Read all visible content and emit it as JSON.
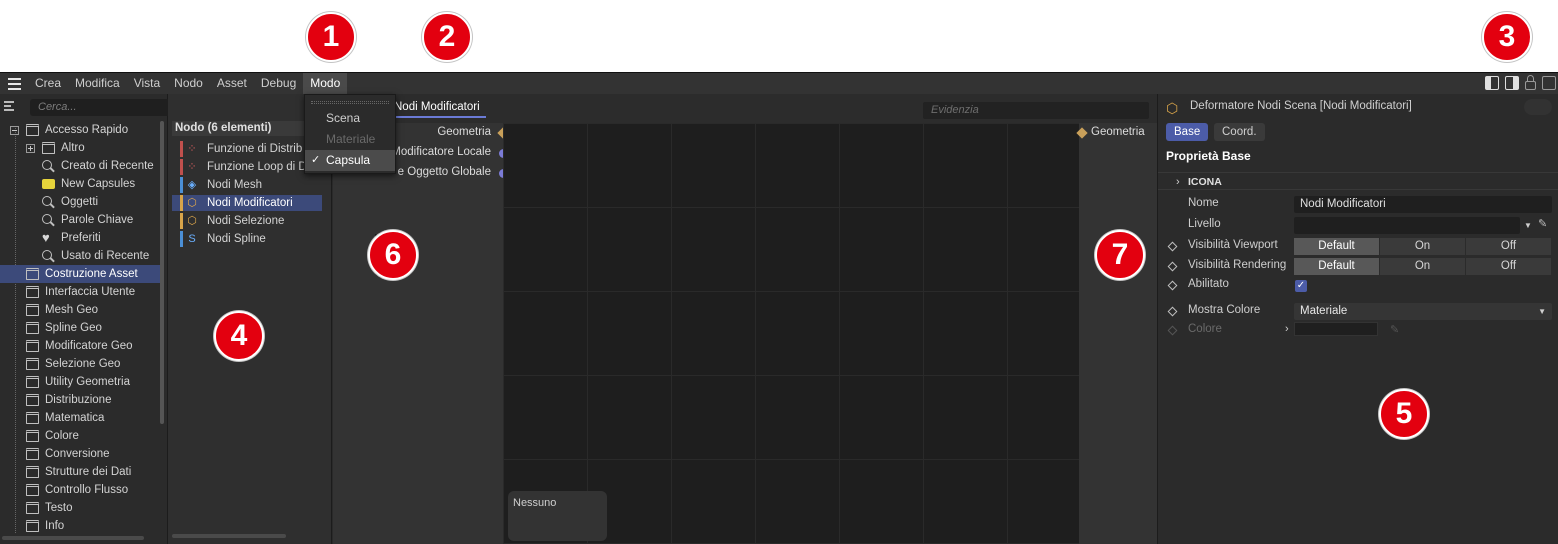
{
  "callouts": [
    "1",
    "2",
    "3",
    "4",
    "5",
    "6",
    "7"
  ],
  "menubar": {
    "items": [
      "Crea",
      "Modifica",
      "Vista",
      "Nodo",
      "Asset",
      "Debug",
      "Modo"
    ],
    "active": "Modo"
  },
  "mode_menu": {
    "items": [
      {
        "label": "Scena",
        "state": "normal"
      },
      {
        "label": "Materiale",
        "state": "disabled"
      },
      {
        "label": "Capsula",
        "state": "checked"
      }
    ],
    "check_glyph": "✓"
  },
  "tree": {
    "search_placeholder": "Cerca...",
    "items": [
      {
        "label": "Accesso Rapido",
        "icon": "database-icon",
        "level": 0,
        "expander": "minus"
      },
      {
        "label": "Altro",
        "icon": "database-icon",
        "level": 1,
        "expander": "plus"
      },
      {
        "label": "Creato di Recente",
        "icon": "search-icon",
        "level": 2
      },
      {
        "label": "New Capsules",
        "icon": "folder-icon",
        "level": 2
      },
      {
        "label": "Oggetti",
        "icon": "search-icon",
        "level": 2
      },
      {
        "label": "Parole Chiave",
        "icon": "search-icon",
        "level": 2
      },
      {
        "label": "Preferiti",
        "icon": "heart-icon",
        "level": 2
      },
      {
        "label": "Usato di Recente",
        "icon": "search-icon",
        "level": 2
      },
      {
        "label": "Costruzione Asset",
        "icon": "database-icon",
        "level": 0,
        "selected": true
      },
      {
        "label": "Interfaccia Utente",
        "icon": "database-icon",
        "level": 0
      },
      {
        "label": "Mesh Geo",
        "icon": "database-icon",
        "level": 0
      },
      {
        "label": "Spline Geo",
        "icon": "database-icon",
        "level": 0
      },
      {
        "label": "Modificatore Geo",
        "icon": "database-icon",
        "level": 0
      },
      {
        "label": "Selezione Geo",
        "icon": "database-icon",
        "level": 0
      },
      {
        "label": "Utility Geometria",
        "icon": "database-icon",
        "level": 0
      },
      {
        "label": "Distribuzione",
        "icon": "database-icon",
        "level": 0
      },
      {
        "label": "Matematica",
        "icon": "database-icon",
        "level": 0
      },
      {
        "label": "Colore",
        "icon": "database-icon",
        "level": 0
      },
      {
        "label": "Conversione",
        "icon": "database-icon",
        "level": 0
      },
      {
        "label": "Strutture dei Dati",
        "icon": "database-icon",
        "level": 0
      },
      {
        "label": "Controllo Flusso",
        "icon": "database-icon",
        "level": 0
      },
      {
        "label": "Testo",
        "icon": "database-icon",
        "level": 0
      },
      {
        "label": "Info",
        "icon": "database-icon",
        "level": 0
      }
    ]
  },
  "node_list": {
    "header": "Nodo (6 elementi)",
    "items": [
      {
        "label": "Funzione di Distrib",
        "strip": "#c0504d",
        "icon": "distribution-icon",
        "icon_color": "#e06060"
      },
      {
        "label": "Funzione Loop di D",
        "strip": "#c0504d",
        "icon": "distribution-icon",
        "icon_color": "#e06060"
      },
      {
        "label": "Nodi Mesh",
        "strip": "#4b8fd6",
        "icon": "mesh-cube-icon",
        "icon_color": "#6ab0ff"
      },
      {
        "label": "Nodi Modificatori",
        "strip": "#d8a44a",
        "icon": "modifier-icon",
        "icon_color": "#e0a84c",
        "selected": true
      },
      {
        "label": "Nodi Selezione",
        "strip": "#d8a44a",
        "icon": "selection-icon",
        "icon_color": "#e0a84c"
      },
      {
        "label": "Nodi Spline",
        "strip": "#4b8fd6",
        "icon": "spline-icon",
        "icon_color": "#6ab0ff"
      }
    ]
  },
  "graph": {
    "tab": "Nodi Modificatori",
    "highlight_placeholder": "Evidenzia",
    "inputs": [
      {
        "label": "Geometria",
        "port": "diamond"
      },
      {
        "label": "Modificatore Locale",
        "port": "dot"
      },
      {
        "label": "e Oggetto Globale",
        "port": "dot"
      }
    ],
    "outputs": [
      {
        "label": "Geometria",
        "port": "diamond"
      }
    ],
    "mini_label": "Nessuno",
    "port_colors": {
      "geometry": "#c9a05a",
      "matrix": "#7b7bd6"
    }
  },
  "attributes": {
    "title": "Deformatore Nodi Scena [Nodi Modificatori]",
    "tabs": [
      "Base",
      "Coord."
    ],
    "active_tab": "Base",
    "section": "Proprietà Base",
    "group": "ICONA",
    "nome_label": "Nome",
    "nome_value": "Nodi Modificatori",
    "livello_label": "Livello",
    "livello_value": "",
    "vis_viewport_label": "Visibilità Viewport",
    "vis_rendering_label": "Visibilità Rendering",
    "visibility_options": [
      "Default",
      "On",
      "Off"
    ],
    "visibility_selected": "Default",
    "abilitato_label": "Abilitato",
    "abilitato_checked": true,
    "mostra_colore_label": "Mostra Colore",
    "mostra_colore_value": "Materiale",
    "colore_label": "Colore",
    "accent_color": "#4c5ca8"
  }
}
